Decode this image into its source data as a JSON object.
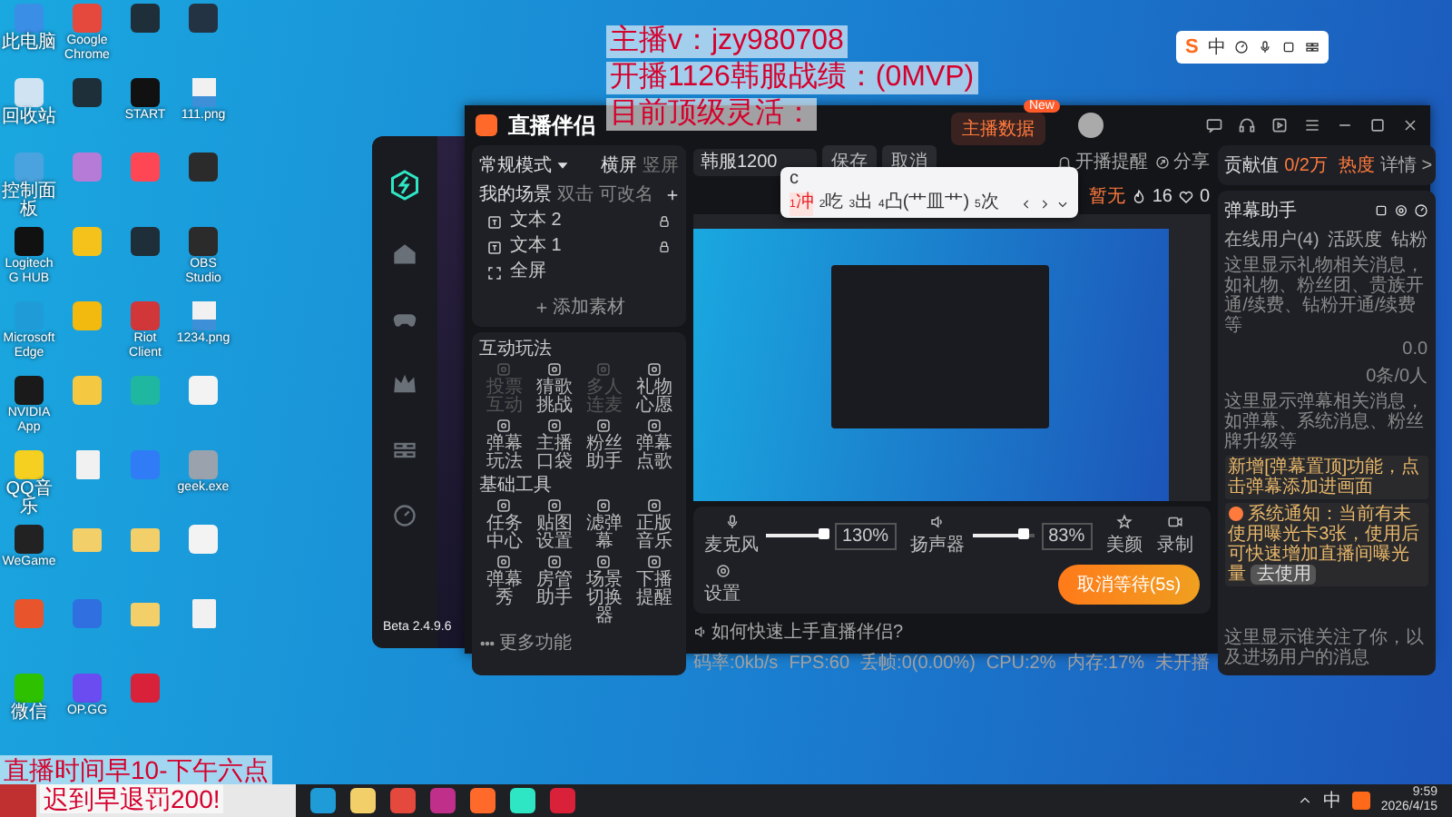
{
  "desktop_icons": [
    {
      "kind": "app",
      "color": "#3a8ee6",
      "label": "此电脑"
    },
    {
      "kind": "app",
      "color": "#cfe3f3",
      "label": "回收站"
    },
    {
      "kind": "app",
      "color": "#4aa3df",
      "label": "控制面板"
    },
    {
      "kind": "app",
      "color": "#111111",
      "label": "Logitech G HUB"
    },
    {
      "kind": "app",
      "color": "#1f9cd8",
      "label": "Microsoft Edge"
    },
    {
      "kind": "app",
      "color": "#1a1a1a",
      "label": "NVIDIA App"
    },
    {
      "kind": "app",
      "color": "#f5d020",
      "label": "QQ音乐"
    },
    {
      "kind": "app",
      "color": "#222222",
      "label": "WeGame"
    },
    {
      "kind": "app",
      "color": "#e8542b"
    },
    {
      "kind": "app",
      "color": "#2dc100",
      "label": "微信"
    },
    {
      "kind": "app",
      "color": "#e5483d",
      "label": "Google Chrome"
    },
    {
      "kind": "app",
      "color": "#1e2f3a"
    },
    {
      "kind": "app",
      "color": "#b57bd6"
    },
    {
      "kind": "app",
      "color": "#f4c21a"
    },
    {
      "kind": "app",
      "color": "#f2b90f"
    },
    {
      "kind": "app",
      "color": "#f5c842"
    },
    {
      "kind": "file"
    },
    {
      "kind": "folder"
    },
    {
      "kind": "app",
      "color": "#2f6fe0"
    },
    {
      "kind": "app",
      "color": "#6a4cf0",
      "label": "OP.GG"
    },
    {
      "kind": "app",
      "color": "#1e2f3a"
    },
    {
      "kind": "app",
      "color": "#111111",
      "label": "START"
    },
    {
      "kind": "app",
      "color": "#ff4655"
    },
    {
      "kind": "app",
      "color": "#1e2f3a"
    },
    {
      "kind": "app",
      "color": "#d13639",
      "label": "Riot Client"
    },
    {
      "kind": "app",
      "color": "#1fb7a0"
    },
    {
      "kind": "app",
      "color": "#2f7cf6"
    },
    {
      "kind": "folder"
    },
    {
      "kind": "folder"
    },
    {
      "kind": "app",
      "color": "#d9213a"
    },
    {
      "kind": "app",
      "color": "#233344"
    },
    {
      "kind": "image",
      "label": "111.png"
    },
    {
      "kind": "app",
      "color": "#2b2b2b"
    },
    {
      "kind": "app",
      "color": "#2b2b2b",
      "label": "OBS Studio"
    },
    {
      "kind": "image",
      "label": "1234.png"
    },
    {
      "kind": "app",
      "color": "#f3f3f3"
    },
    {
      "kind": "app",
      "color": "#9aa3ad",
      "label": "geek.exe"
    },
    {
      "kind": "app",
      "color": "#f3f3f3"
    },
    {
      "kind": "file"
    }
  ],
  "overlay_text": {
    "top_lines": [
      "主播v：jzy980708",
      "开播1126韩服战绩：(0MVP)",
      "目前顶级灵活："
    ],
    "bottom_lines": [
      "直播时间早10-下午六点",
      "迟到早退罚200!"
    ]
  },
  "launcher": {
    "version": "Beta 2.4.9.6"
  },
  "studio": {
    "title": "直播伴侣",
    "mode": "常规模式",
    "orientations": [
      {
        "label": "横屏",
        "selected": true
      },
      {
        "label": "竖屏",
        "selected": false
      }
    ],
    "scenes_header": "我的场景",
    "scene_hints": [
      "双击",
      "可改名"
    ],
    "scene_items": [
      {
        "label": "文本 2",
        "kind": "text"
      },
      {
        "label": "文本 1",
        "kind": "text"
      },
      {
        "label": "全屏",
        "kind": "capture"
      }
    ],
    "add_source": "添加素材",
    "sections": [
      {
        "title": "互动玩法",
        "tools": [
          {
            "label": "投票互动",
            "disabled": true
          },
          {
            "label": "猜歌挑战",
            "disabled": false
          },
          {
            "label": "多人连麦",
            "disabled": true
          },
          {
            "label": "礼物心愿",
            "disabled": false
          },
          {
            "label": "弹幕玩法",
            "disabled": false
          },
          {
            "label": "主播口袋",
            "disabled": false
          },
          {
            "label": "粉丝助手",
            "disabled": false
          },
          {
            "label": "弹幕点歌",
            "disabled": false
          }
        ]
      },
      {
        "title": "基础工具",
        "tools": [
          {
            "label": "任务中心",
            "disabled": false
          },
          {
            "label": "贴图设置",
            "disabled": false
          },
          {
            "label": "滤弹幕",
            "disabled": false
          },
          {
            "label": "正版音乐",
            "disabled": false
          },
          {
            "label": "弹幕秀",
            "disabled": false
          },
          {
            "label": "房管助手",
            "disabled": false
          },
          {
            "label": "场景切换器",
            "disabled": false
          },
          {
            "label": "下播提醒",
            "disabled": false
          }
        ]
      }
    ],
    "more": "更多功能",
    "room_title": "韩服1200",
    "save": "保存",
    "cancel": "取消",
    "data_button": "主播数据",
    "new_badge": "New",
    "remind": "开播提醒",
    "share": "分享",
    "status": "暂无",
    "likes": "16",
    "hearts": "0",
    "audio": [
      {
        "label": "麦克风",
        "kind": "mic",
        "level": 0.95,
        "reading": "130%"
      },
      {
        "label": "扬声器",
        "kind": "speaker",
        "level": 0.85,
        "reading": "83%"
      }
    ],
    "tools": [
      {
        "label": "美颜",
        "kind": "beauty"
      },
      {
        "label": "录制",
        "kind": "record"
      },
      {
        "label": "设置",
        "kind": "settings"
      }
    ],
    "start_button": "取消等待(5s)",
    "help": "如何快速上手直播伴侣?",
    "stats": [
      "码率:0kb/s",
      "FPS:60",
      "丢帧:0(0.00%)",
      "CPU:2%",
      "内存:17%",
      "未开播"
    ]
  },
  "ime": {
    "input": "c",
    "candidates": [
      {
        "index": "1",
        "text": "冲",
        "selected": true
      },
      {
        "index": "2",
        "text": "吃",
        "selected": false
      },
      {
        "index": "3",
        "text": "出",
        "selected": false
      },
      {
        "index": "4",
        "text": "凸(艹皿艹)",
        "selected": false
      },
      {
        "index": "5",
        "text": "次",
        "selected": false
      }
    ]
  },
  "side": {
    "contribution_label": "贡献值",
    "contribution": "0/2万",
    "heat": "热度",
    "details": "详情 >",
    "panel_title": "弹幕助手",
    "tabs": [
      {
        "label": "在线用户(4)",
        "selected": false
      },
      {
        "label": "活跃度",
        "selected": false
      },
      {
        "label": "钻粉",
        "selected": false
      }
    ],
    "gift_hint": "这里显示礼物相关消息，如礼物、粉丝团、贵族开通/续费、钻粉开通/续费等",
    "gift_value": "0.0",
    "danmaku_count": "0条/0人",
    "danmaku_hint": "这里显示弹幕相关消息，如弹幕、系统消息、粉丝牌升级等",
    "notices": [
      {
        "kind": "tip",
        "text": "新增[弹幕置顶]功能，点击弹幕添加进画面"
      },
      {
        "kind": "system",
        "text": "系统通知：当前有未使用曝光卡3张，使用后可快速增加直播间曝光量",
        "action": "去使用"
      }
    ],
    "follow_hint": "这里显示谁关注了你，以及进场用户的消息"
  },
  "ime_bar": {
    "logo": "S",
    "mode": "中"
  },
  "taskbar": {
    "lang": "中",
    "time": "9:59",
    "date": "2026/4/15"
  }
}
